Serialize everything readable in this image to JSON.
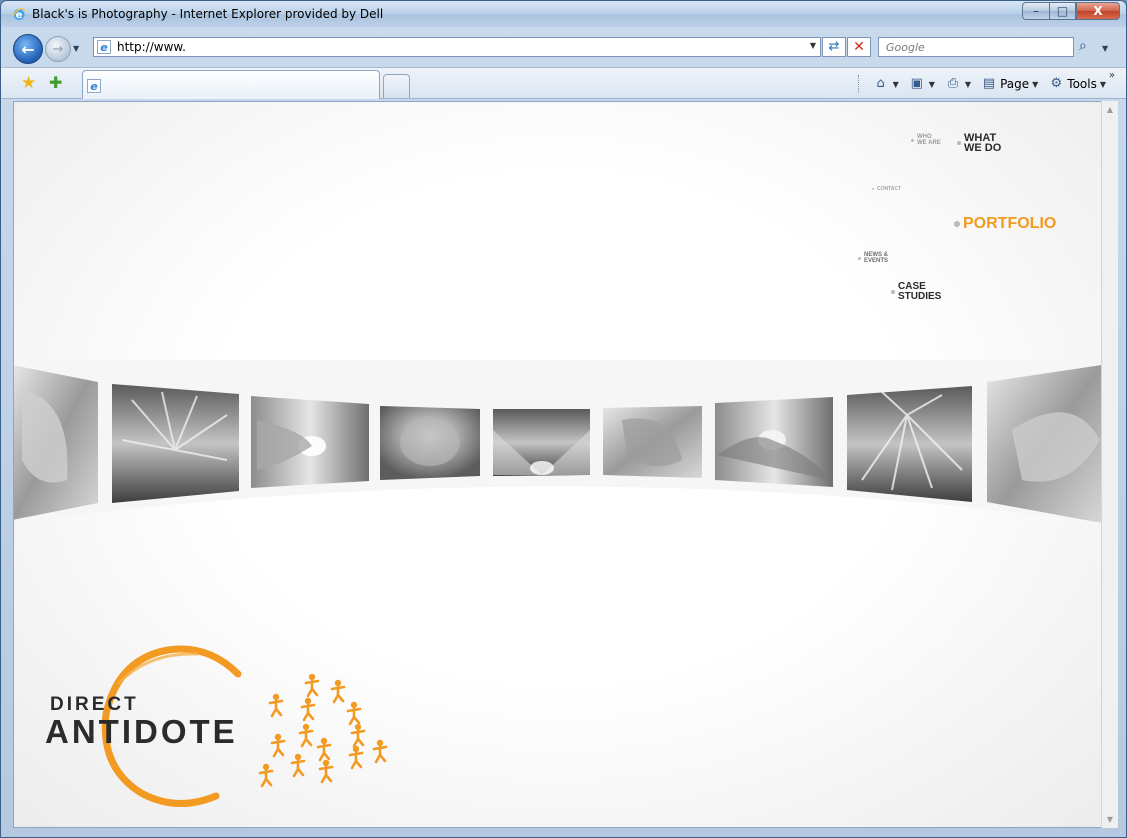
{
  "window": {
    "title": "Black's is Photography - Internet Explorer provided by Dell",
    "min_symbol": "–",
    "max_symbol": "□",
    "close_symbol": "X"
  },
  "navbar": {
    "back_symbol": "←",
    "forward_symbol": "→",
    "dropdown_symbol": "▼",
    "address": "http://www.",
    "refresh_symbol": "⇄",
    "stop_symbol": "✕",
    "search_placeholder": "Google",
    "search_symbol": "⌕"
  },
  "commandbar": {
    "fav_symbol": "★",
    "add_fav_symbol": "✚",
    "home_symbol": "⌂",
    "feeds_symbol": "▣",
    "print_symbol": "⎙",
    "page_label": "Page",
    "tools_label": "Tools",
    "tools_symbol": "⚙",
    "more_symbol": "»",
    "dropdown_symbol": "▼"
  },
  "site": {
    "nav": {
      "who_we_are": [
        "WHO",
        "WE ARE"
      ],
      "what_we_do": [
        "WHAT",
        "WE DO"
      ],
      "contact": "CONTACT",
      "portfolio": "PORTFOLIO",
      "news_events": [
        "NEWS &",
        "EVENTS"
      ],
      "case_studies": [
        "CASE",
        "STUDIES"
      ]
    },
    "logo": {
      "top": "DIRECT",
      "bottom": "ANTIDOTE"
    },
    "accent_color": "#f29a22",
    "text_color": "#2b2b2b"
  },
  "scrollbar": {
    "up_symbol": "▲",
    "down_symbol": "▼"
  }
}
